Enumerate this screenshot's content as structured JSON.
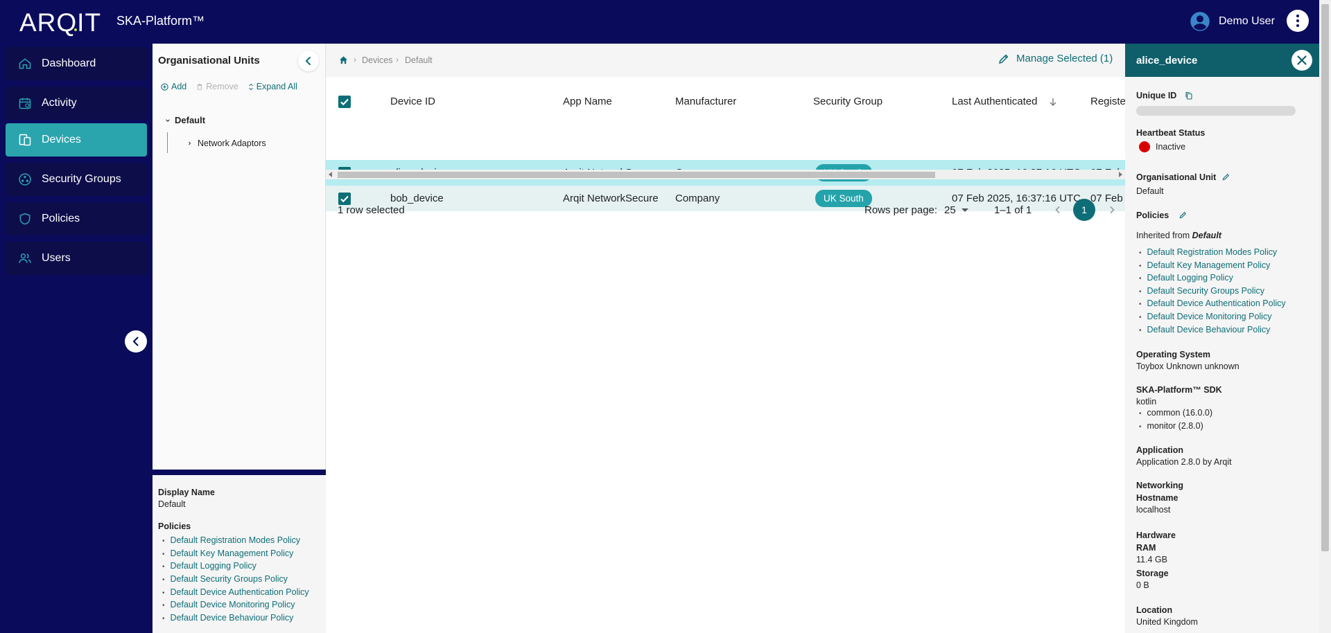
{
  "header": {
    "logo": "ARQIT",
    "platform": "SKA-Platform™",
    "user_name": "Demo User",
    "icons": {
      "avatar": "account-circle-icon",
      "menu": "more-vertical-icon"
    }
  },
  "nav": {
    "items": [
      {
        "label": "Dashboard",
        "icon": "home-icon"
      },
      {
        "label": "Activity",
        "icon": "calendar-icon"
      },
      {
        "label": "Devices",
        "icon": "devices-icon",
        "active": true
      },
      {
        "label": "Security Groups",
        "icon": "security-groups-icon"
      },
      {
        "label": "Policies",
        "icon": "shield-icon"
      },
      {
        "label": "Users",
        "icon": "users-icon"
      }
    ]
  },
  "org_panel": {
    "title": "Organisational Units",
    "actions": {
      "add": "Add",
      "remove": "Remove",
      "expand_all": "Expand All"
    },
    "tree": {
      "root": "Default",
      "child": "Network Adaptors"
    }
  },
  "org_details": {
    "display_name_label": "Display Name",
    "display_name_value": "Default",
    "policies_label": "Policies",
    "policies": [
      "Default Registration Modes Policy",
      "Default Key Management Policy",
      "Default Logging Policy",
      "Default Security Groups Policy",
      "Default Device Authentication Policy",
      "Default Device Monitoring Policy",
      "Default Device Behaviour Policy"
    ]
  },
  "breadcrumb": {
    "items": [
      "Devices",
      "Default"
    ],
    "separator": "›"
  },
  "manage_selected": "Manage Selected (1)",
  "table": {
    "columns": [
      "Device ID",
      "App Name",
      "Manufacturer",
      "Security Group",
      "Last Authenticated",
      "Registe"
    ],
    "rows": [
      {
        "device_id": "alice_device",
        "app_name": "Arqit NetworkSecure",
        "manufacturer": "Company",
        "security_group": "UK South",
        "last_authenticated": "07 Feb 2025, 16:37:16 UTC",
        "registered": "07 Feb",
        "checked": true
      },
      {
        "device_id": "bob_device",
        "app_name": "Arqit NetworkSecure",
        "manufacturer": "Company",
        "security_group": "UK South",
        "last_authenticated": "07 Feb 2025, 16:37:16 UTC",
        "registered": "07 Feb",
        "checked": true
      }
    ]
  },
  "footer": {
    "selected_text": "1 row selected",
    "rows_per_page_label": "Rows per page:",
    "rows_per_page_value": "25",
    "page_range": "1–1 of 1",
    "current_page": "1"
  },
  "detail": {
    "title": "alice_device",
    "unique_id_label": "Unique ID",
    "heartbeat_label": "Heartbeat Status",
    "heartbeat_value": "Inactive",
    "heartbeat_color": "#d90000",
    "org_unit_label": "Organisational Unit",
    "org_unit_value": "Default",
    "policies_label": "Policies",
    "inherited_prefix": "Inherited from ",
    "inherited_source": "Default",
    "policies": [
      "Default Registration Modes Policy",
      "Default Key Management Policy",
      "Default Logging Policy",
      "Default Security Groups Policy",
      "Default Device Authentication Policy",
      "Default Device Monitoring Policy",
      "Default Device Behaviour Policy"
    ],
    "os_label": "Operating System",
    "os_value": "Toybox Unknown unknown",
    "sdk_label": "SKA-Platform™ SDK",
    "sdk_value": "kotlin",
    "sdk_items": [
      "common (16.0.0)",
      "monitor (2.8.0)"
    ],
    "application_label": "Application",
    "application_value": "Application 2.8.0 by Arqit",
    "networking_label": "Networking",
    "hostname_label": "Hostname",
    "hostname_value": "localhost",
    "hardware_label": "Hardware",
    "ram_label": "RAM",
    "ram_value": "11.4 GB",
    "storage_label": "Storage",
    "storage_value": "0 B",
    "location_label": "Location",
    "location_value": "United Kingdom"
  },
  "colors": {
    "brand_navy": "#0b0b5c",
    "accent_teal": "#0e6e77",
    "active_nav": "#2aa5ad",
    "selected_row": "#b4ecf0",
    "badge": "#24a3ab"
  }
}
